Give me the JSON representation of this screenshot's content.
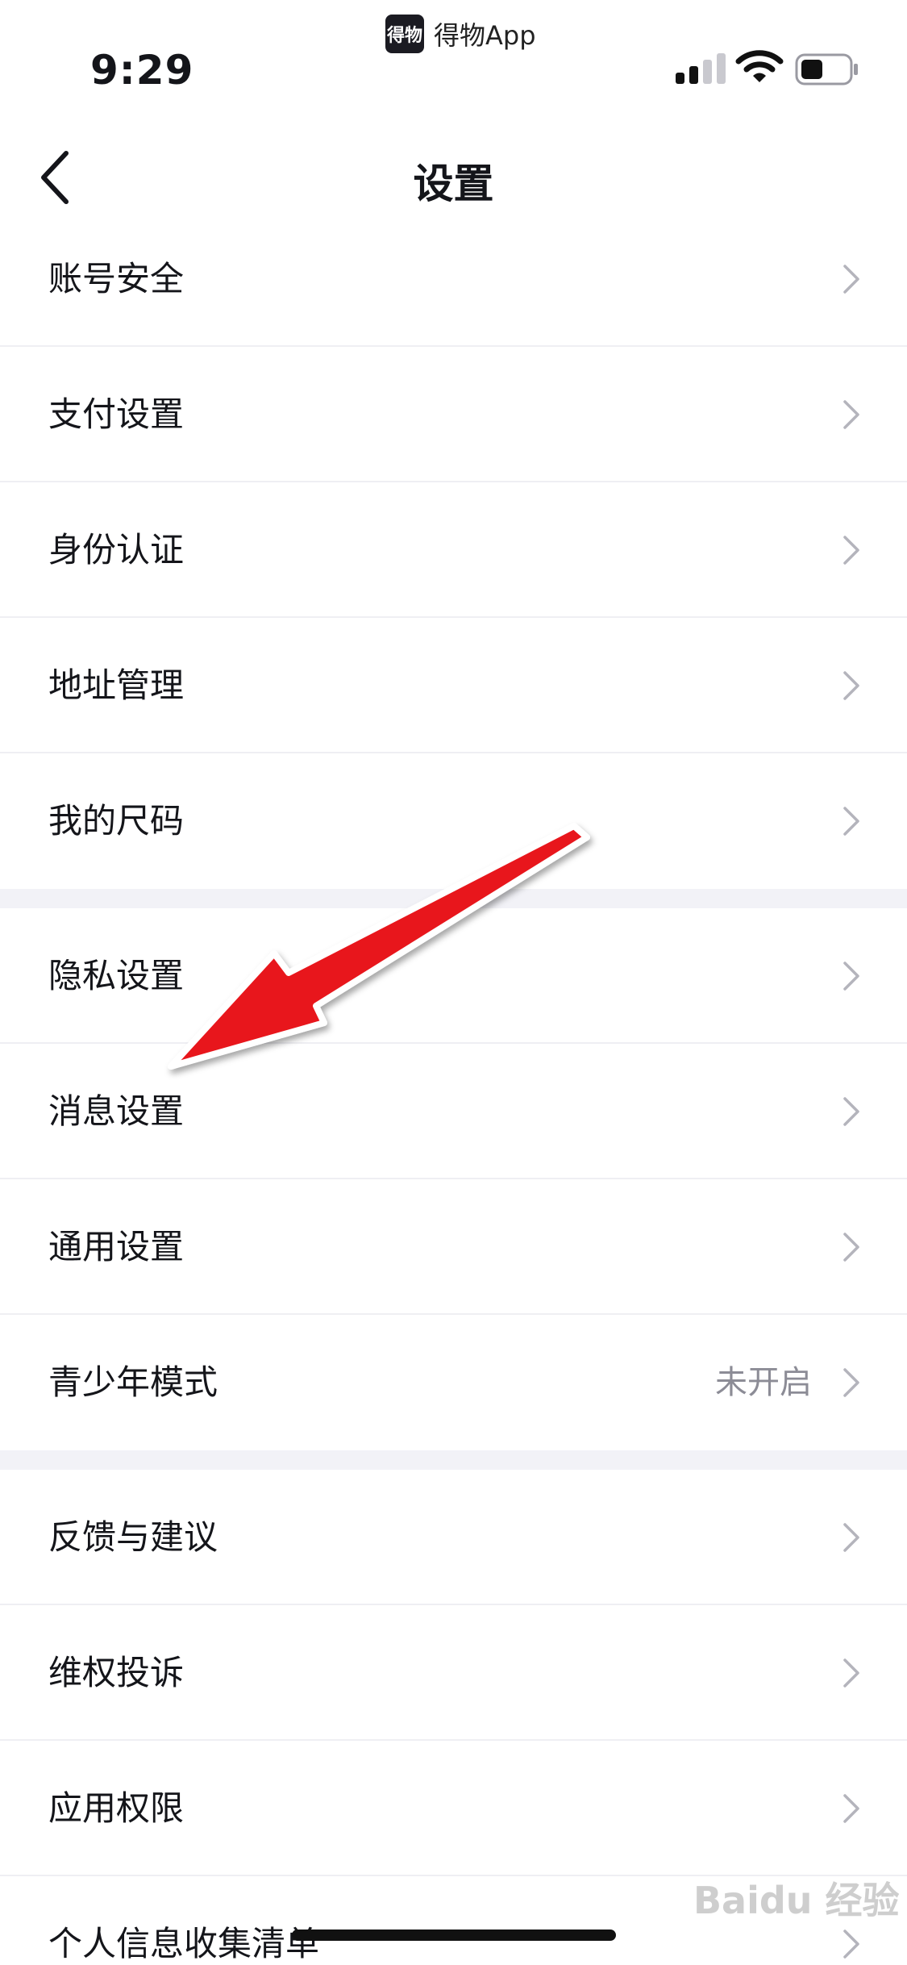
{
  "status_bar": {
    "time": "9:29",
    "app_badge": {
      "logo_text": "得物",
      "name": "得物App"
    }
  },
  "nav": {
    "title": "设置",
    "back_icon": "chevron-left-icon"
  },
  "settings": {
    "groups": [
      {
        "items": [
          {
            "label": "账号安全"
          },
          {
            "label": "支付设置"
          },
          {
            "label": "身份认证"
          },
          {
            "label": "地址管理"
          },
          {
            "label": "我的尺码"
          }
        ]
      },
      {
        "items": [
          {
            "label": "隐私设置"
          },
          {
            "label": "消息设置"
          },
          {
            "label": "通用设置"
          },
          {
            "label": "青少年模式",
            "value": "未开启"
          }
        ]
      },
      {
        "items": [
          {
            "label": "反馈与建议"
          },
          {
            "label": "维权投诉"
          },
          {
            "label": "应用权限"
          },
          {
            "label": "个人信息收集清单"
          }
        ]
      }
    ]
  },
  "watermark": "Baidu 经验",
  "colors": {
    "annotation_arrow": "#e8161b",
    "section_gap": "#f2f2f7",
    "chevron": "#b4b4bc"
  }
}
